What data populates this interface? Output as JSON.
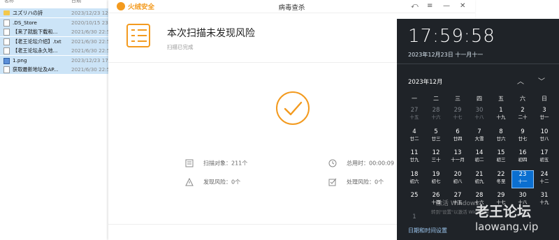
{
  "explorer": {
    "col_name": "名称",
    "col_date": "日期",
    "files": [
      {
        "name": "ユズリハの詩",
        "date": "2023/12/23 12",
        "type": "folder",
        "selected": true
      },
      {
        "name": ".DS_Store",
        "date": "2020/10/15 23",
        "type": "file",
        "selected": true
      },
      {
        "name": "【来了就能下载和...",
        "date": "2021/6/30 22:5",
        "type": "file",
        "selected": true
      },
      {
        "name": "【老王论坛介绍】.txt",
        "date": "2021/6/30 22:5",
        "type": "file",
        "selected": true
      },
      {
        "name": "【老王论坛永久地...",
        "date": "2021/6/30 22:5",
        "type": "file",
        "selected": true
      },
      {
        "name": "1.png",
        "date": "2023/12/23 17",
        "type": "image",
        "selected": true
      },
      {
        "name": "获取最新地址及AP...",
        "date": "2021/6/30 22:5",
        "type": "file",
        "selected": true
      }
    ]
  },
  "app": {
    "brand": "火绒安全",
    "title": "病毒查杀",
    "controls": {
      "back": "⤺",
      "menu": "≡",
      "minimize": "—",
      "close": "✕"
    },
    "result_title": "本次扫描未发现风险",
    "result_subtitle": "扫描已完成",
    "stats": {
      "scanned": "扫描对象：211个",
      "total_time": "总用时：00:00:09",
      "risks_found": "发现风险：0个",
      "risks_handled": "处理风险：0个"
    },
    "accent": "#f39a1e"
  },
  "calendar": {
    "time": "17:59:58",
    "date_long": "2023年12月23日 十一月十一",
    "month_label": "2023年12月",
    "nav_up": "︿",
    "nav_down": "﹀",
    "weekdays": [
      "一",
      "二",
      "三",
      "四",
      "五",
      "六",
      "日"
    ],
    "days": [
      {
        "d": "27",
        "l": "十五",
        "dim": true
      },
      {
        "d": "28",
        "l": "十六",
        "dim": true
      },
      {
        "d": "29",
        "l": "十七",
        "dim": true
      },
      {
        "d": "30",
        "l": "十八",
        "dim": true
      },
      {
        "d": "1",
        "l": "十九"
      },
      {
        "d": "2",
        "l": "二十"
      },
      {
        "d": "3",
        "l": "廿一"
      },
      {
        "d": "4",
        "l": "廿二"
      },
      {
        "d": "5",
        "l": "廿三"
      },
      {
        "d": "6",
        "l": "廿四"
      },
      {
        "d": "7",
        "l": "大雪"
      },
      {
        "d": "8",
        "l": "廿六"
      },
      {
        "d": "9",
        "l": "廿七"
      },
      {
        "d": "10",
        "l": "廿八"
      },
      {
        "d": "11",
        "l": "廿九"
      },
      {
        "d": "12",
        "l": "三十"
      },
      {
        "d": "13",
        "l": "十一月"
      },
      {
        "d": "14",
        "l": "初二"
      },
      {
        "d": "15",
        "l": "初三"
      },
      {
        "d": "16",
        "l": "初四"
      },
      {
        "d": "17",
        "l": "初五"
      },
      {
        "d": "18",
        "l": "初六"
      },
      {
        "d": "19",
        "l": "初七"
      },
      {
        "d": "20",
        "l": "初八"
      },
      {
        "d": "21",
        "l": "初九"
      },
      {
        "d": "22",
        "l": "冬至"
      },
      {
        "d": "23",
        "l": "十一",
        "today": true
      },
      {
        "d": "24",
        "l": "十二"
      },
      {
        "d": "25",
        "l": ""
      },
      {
        "d": "26",
        "l": "十四"
      },
      {
        "d": "27",
        "l": "十五"
      },
      {
        "d": "28",
        "l": "十六"
      },
      {
        "d": "29",
        "l": "十七"
      },
      {
        "d": "30",
        "l": "十八"
      },
      {
        "d": "31",
        "l": "十九"
      },
      {
        "d": "1",
        "l": "",
        "dim": true
      }
    ],
    "settings_link": "日期和时间设置",
    "activate_watermark": "激活 Windows",
    "activate_hint": "转到\"设置\"以激活 Windows"
  },
  "watermark": {
    "cn": "老王论坛",
    "en": "laowang.vip"
  }
}
